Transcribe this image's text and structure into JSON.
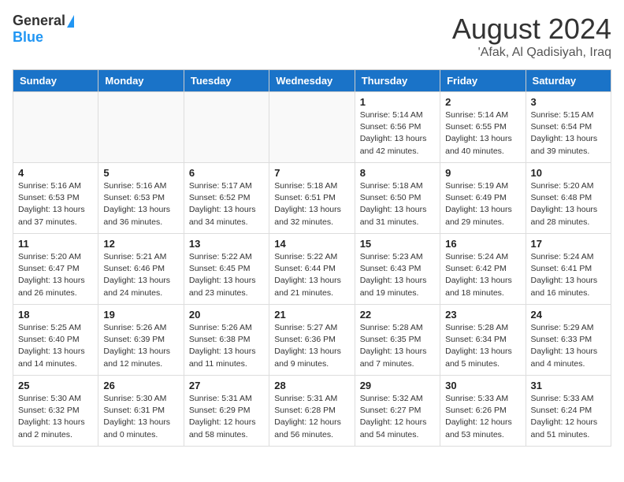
{
  "header": {
    "logo_general": "General",
    "logo_blue": "Blue",
    "month_title": "August 2024",
    "location": "'Afak, Al Qadisiyah, Iraq"
  },
  "days_of_week": [
    "Sunday",
    "Monday",
    "Tuesday",
    "Wednesday",
    "Thursday",
    "Friday",
    "Saturday"
  ],
  "weeks": [
    [
      {
        "day": "",
        "info": ""
      },
      {
        "day": "",
        "info": ""
      },
      {
        "day": "",
        "info": ""
      },
      {
        "day": "",
        "info": ""
      },
      {
        "day": "1",
        "info": "Sunrise: 5:14 AM\nSunset: 6:56 PM\nDaylight: 13 hours\nand 42 minutes."
      },
      {
        "day": "2",
        "info": "Sunrise: 5:14 AM\nSunset: 6:55 PM\nDaylight: 13 hours\nand 40 minutes."
      },
      {
        "day": "3",
        "info": "Sunrise: 5:15 AM\nSunset: 6:54 PM\nDaylight: 13 hours\nand 39 minutes."
      }
    ],
    [
      {
        "day": "4",
        "info": "Sunrise: 5:16 AM\nSunset: 6:53 PM\nDaylight: 13 hours\nand 37 minutes."
      },
      {
        "day": "5",
        "info": "Sunrise: 5:16 AM\nSunset: 6:53 PM\nDaylight: 13 hours\nand 36 minutes."
      },
      {
        "day": "6",
        "info": "Sunrise: 5:17 AM\nSunset: 6:52 PM\nDaylight: 13 hours\nand 34 minutes."
      },
      {
        "day": "7",
        "info": "Sunrise: 5:18 AM\nSunset: 6:51 PM\nDaylight: 13 hours\nand 32 minutes."
      },
      {
        "day": "8",
        "info": "Sunrise: 5:18 AM\nSunset: 6:50 PM\nDaylight: 13 hours\nand 31 minutes."
      },
      {
        "day": "9",
        "info": "Sunrise: 5:19 AM\nSunset: 6:49 PM\nDaylight: 13 hours\nand 29 minutes."
      },
      {
        "day": "10",
        "info": "Sunrise: 5:20 AM\nSunset: 6:48 PM\nDaylight: 13 hours\nand 28 minutes."
      }
    ],
    [
      {
        "day": "11",
        "info": "Sunrise: 5:20 AM\nSunset: 6:47 PM\nDaylight: 13 hours\nand 26 minutes."
      },
      {
        "day": "12",
        "info": "Sunrise: 5:21 AM\nSunset: 6:46 PM\nDaylight: 13 hours\nand 24 minutes."
      },
      {
        "day": "13",
        "info": "Sunrise: 5:22 AM\nSunset: 6:45 PM\nDaylight: 13 hours\nand 23 minutes."
      },
      {
        "day": "14",
        "info": "Sunrise: 5:22 AM\nSunset: 6:44 PM\nDaylight: 13 hours\nand 21 minutes."
      },
      {
        "day": "15",
        "info": "Sunrise: 5:23 AM\nSunset: 6:43 PM\nDaylight: 13 hours\nand 19 minutes."
      },
      {
        "day": "16",
        "info": "Sunrise: 5:24 AM\nSunset: 6:42 PM\nDaylight: 13 hours\nand 18 minutes."
      },
      {
        "day": "17",
        "info": "Sunrise: 5:24 AM\nSunset: 6:41 PM\nDaylight: 13 hours\nand 16 minutes."
      }
    ],
    [
      {
        "day": "18",
        "info": "Sunrise: 5:25 AM\nSunset: 6:40 PM\nDaylight: 13 hours\nand 14 minutes."
      },
      {
        "day": "19",
        "info": "Sunrise: 5:26 AM\nSunset: 6:39 PM\nDaylight: 13 hours\nand 12 minutes."
      },
      {
        "day": "20",
        "info": "Sunrise: 5:26 AM\nSunset: 6:38 PM\nDaylight: 13 hours\nand 11 minutes."
      },
      {
        "day": "21",
        "info": "Sunrise: 5:27 AM\nSunset: 6:36 PM\nDaylight: 13 hours\nand 9 minutes."
      },
      {
        "day": "22",
        "info": "Sunrise: 5:28 AM\nSunset: 6:35 PM\nDaylight: 13 hours\nand 7 minutes."
      },
      {
        "day": "23",
        "info": "Sunrise: 5:28 AM\nSunset: 6:34 PM\nDaylight: 13 hours\nand 5 minutes."
      },
      {
        "day": "24",
        "info": "Sunrise: 5:29 AM\nSunset: 6:33 PM\nDaylight: 13 hours\nand 4 minutes."
      }
    ],
    [
      {
        "day": "25",
        "info": "Sunrise: 5:30 AM\nSunset: 6:32 PM\nDaylight: 13 hours\nand 2 minutes."
      },
      {
        "day": "26",
        "info": "Sunrise: 5:30 AM\nSunset: 6:31 PM\nDaylight: 13 hours\nand 0 minutes."
      },
      {
        "day": "27",
        "info": "Sunrise: 5:31 AM\nSunset: 6:29 PM\nDaylight: 12 hours\nand 58 minutes."
      },
      {
        "day": "28",
        "info": "Sunrise: 5:31 AM\nSunset: 6:28 PM\nDaylight: 12 hours\nand 56 minutes."
      },
      {
        "day": "29",
        "info": "Sunrise: 5:32 AM\nSunset: 6:27 PM\nDaylight: 12 hours\nand 54 minutes."
      },
      {
        "day": "30",
        "info": "Sunrise: 5:33 AM\nSunset: 6:26 PM\nDaylight: 12 hours\nand 53 minutes."
      },
      {
        "day": "31",
        "info": "Sunrise: 5:33 AM\nSunset: 6:24 PM\nDaylight: 12 hours\nand 51 minutes."
      }
    ]
  ]
}
